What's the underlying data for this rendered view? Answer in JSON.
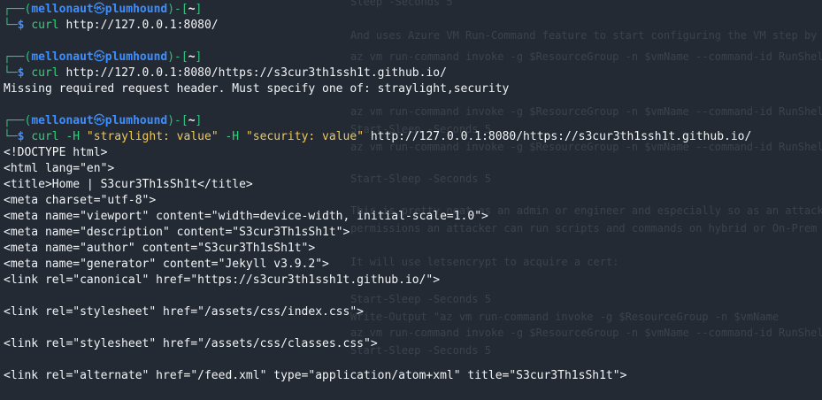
{
  "terminal": {
    "user": "mellonaut",
    "host": "plumhound",
    "cwd": "~",
    "prompt_symbol": "$",
    "blocks": [
      {
        "command": "curl",
        "args": [
          {
            "text": " http://127.0.0.1:8080/",
            "style": "plain"
          }
        ],
        "output": []
      },
      {
        "command": "curl",
        "args": [
          {
            "text": " http://127.0.0.1:8080/https://s3cur3th1ssh1t.github.io/",
            "style": "plain"
          }
        ],
        "output": [
          "Missing required request header. Must specify one of: straylight,security"
        ]
      },
      {
        "command": "curl",
        "args": [
          {
            "text": " -H",
            "style": "cmd"
          },
          {
            "text": " \"straylight: value\"",
            "style": "yellow"
          },
          {
            "text": " -H",
            "style": "cmd"
          },
          {
            "text": " \"security: value\"",
            "style": "yellow"
          },
          {
            "text": " http://127.0.0.1:8080/https://s3cur3th1ssh1t.github.io/",
            "style": "plain"
          }
        ],
        "output": [
          "<!DOCTYPE html>",
          "<html lang=\"en\">",
          "<title>Home | S3cur3Th1sSh1t</title>",
          "<meta charset=\"utf-8\">",
          "<meta name=\"viewport\" content=\"width=device-width, initial-scale=1.0\">",
          "<meta name=\"description\" content=\"S3cur3Th1sSh1t\">",
          "<meta name=\"author\" content=\"S3cur3Th1sSh1t\">",
          "<meta name=\"generator\" content=\"Jekyll v3.9.2\">",
          "<link rel=\"canonical\" href=\"https://s3cur3th1ssh1t.github.io/\">",
          "",
          "<link rel=\"stylesheet\" href=\"/assets/css/index.css\">",
          "",
          "<link rel=\"stylesheet\" href=\"/assets/css/classes.css\">",
          "",
          "<link rel=\"alternate\" href=\"/feed.xml\" type=\"application/atom+xml\" title=\"S3cur3Th1sSh1t\">"
        ]
      }
    ]
  },
  "background_page": {
    "lines": [
      "Sleep -Seconds 5",
      "And uses Azure VM Run-Command feature to start configuring the VM step by step:",
      "az vm run-command invoke -g $ResourceGroup -n $vmName --command-id RunShellScript",
      "az vm run-command invoke -g $ResourceGroup -n $vmName --command-id RunShellScript",
      "Start-Sleep -Seconds 5",
      "az vm run-command invoke -g $ResourceGroup -n $vmName --command-id RunShellScript",
      "Start-Sleep -Seconds 5",
      "This is pretty neat as an admin or engineer and especially so as an attacker. With the right",
      "permissions an attacker can run scripts and commands on hybrid or On-Prem devices with",
      "It will use letsencrypt to acquire a cert:",
      "Start-Sleep -Seconds 5",
      "Write-Output \"az vm run-command invoke -g $ResourceGroup -n $vmName",
      "az vm run-command invoke -g $ResourceGroup -n $vmName --command-id RunShellScript",
      "Start-Sleep -Seconds 5"
    ]
  },
  "colors": {
    "background": "#242a33",
    "prompt_line": "#2ec27e",
    "user_host": "#3d8fff",
    "cwd": "#f4f6f8",
    "command": "#33d17a",
    "string_arg": "#f0c85a",
    "text": "#f2f4f6"
  }
}
